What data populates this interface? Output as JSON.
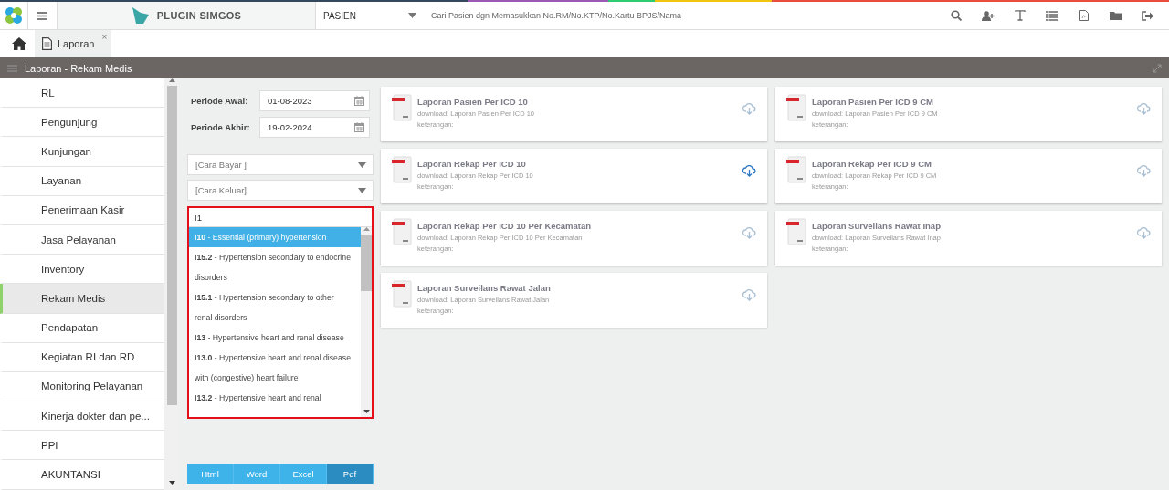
{
  "header": {
    "brand": "PLUGIN SIMGOS",
    "category": "PASIEN",
    "search_placeholder": "Cari Pasien dgn Memasukkan No.RM/No.KTP/No.Kartu BPJS/Nama"
  },
  "tabs": [
    {
      "label": "Laporan",
      "selected": true,
      "close": "×"
    }
  ],
  "section_title": "Laporan - Rekam Medis",
  "sidebar": {
    "items": [
      {
        "label": "RL",
        "selected": false
      },
      {
        "label": "Pengunjung",
        "selected": false
      },
      {
        "label": "Kunjungan",
        "selected": false
      },
      {
        "label": "Layanan",
        "selected": false
      },
      {
        "label": "Penerimaan Kasir",
        "selected": false
      },
      {
        "label": "Jasa Pelayanan",
        "selected": false
      },
      {
        "label": "Inventory",
        "selected": false
      },
      {
        "label": "Rekam Medis",
        "selected": true
      },
      {
        "label": "Pendapatan",
        "selected": false
      },
      {
        "label": "Kegiatan RI dan RD",
        "selected": false
      },
      {
        "label": "Monitoring Pelayanan",
        "selected": false
      },
      {
        "label": "Kinerja dokter dan pe...",
        "selected": false
      },
      {
        "label": "PPI",
        "selected": false
      },
      {
        "label": "AKUNTANSI",
        "selected": false
      }
    ]
  },
  "filters": {
    "dates": [
      {
        "label": "Periode Awal:",
        "value": "01-08-2023"
      },
      {
        "label": "Periode Akhir:",
        "value": "19-02-2024"
      }
    ],
    "selects": [
      {
        "placeholder": "[Cara Bayar ]"
      },
      {
        "placeholder": "[Cara Keluar]"
      }
    ],
    "diagnosis": {
      "value": "I1",
      "options": [
        {
          "text": "**I10** - Essential (primary) hypertension",
          "selected": true
        },
        {
          "text": "**I15.2** - Hypertension secondary to endocrine disorders",
          "selected": false
        },
        {
          "text": "**I15.1** - Hypertension secondary to other renal disorders",
          "selected": false
        },
        {
          "text": "**I13** - Hypertensive heart and renal disease",
          "selected": false
        },
        {
          "text": "**I13.0** - Hypertensive heart and renal disease with (congestive) heart failure",
          "selected": false
        },
        {
          "text": "**I13.2** - Hypertensive heart and renal",
          "selected": false
        }
      ]
    }
  },
  "export_buttons": [
    {
      "label": "Html",
      "selected": false
    },
    {
      "label": "Word",
      "selected": false
    },
    {
      "label": "Excel",
      "selected": false
    },
    {
      "label": "Pdf",
      "selected": true
    }
  ],
  "report_columns": [
    {
      "reports": [
        {
          "title": "Laporan Pasien Per ICD 10",
          "download": "download: Laporan Pasien Per ICD 10",
          "note": "keterangan:",
          "highlighted": false
        },
        {
          "title": "Laporan Rekap Per ICD 10",
          "download": "download: Laporan Rekap Per ICD 10",
          "note": "keterangan:",
          "highlighted": true
        },
        {
          "title": "Laporan Rekap Per ICD 10 Per Kecamatan",
          "download": "download: Laporan Rekap Per ICD 10 Per Kecamatan",
          "note": "keterangan:",
          "highlighted": false
        },
        {
          "title": "Laporan Surveilans Rawat Jalan",
          "download": "download: Laporan Surveilans Rawat Jalan",
          "note": "keterangan:",
          "highlighted": false
        }
      ]
    },
    {
      "reports": [
        {
          "title": "Laporan Pasien Per ICD 9 CM",
          "download": "download: Laporan Pasien Per ICD 9 CM",
          "note": "keterangan:",
          "highlighted": false
        },
        {
          "title": "Laporan Rekap Per ICD 9 CM",
          "download": "download: Laporan Rekap Per ICD 9 CM",
          "note": "keterangan:",
          "highlighted": false
        },
        {
          "title": "Laporan Surveilans Rawat Inap",
          "download": "download: Laporan Surveilans Rawat Inap",
          "note": "keterangan:",
          "highlighted": false
        }
      ]
    }
  ]
}
